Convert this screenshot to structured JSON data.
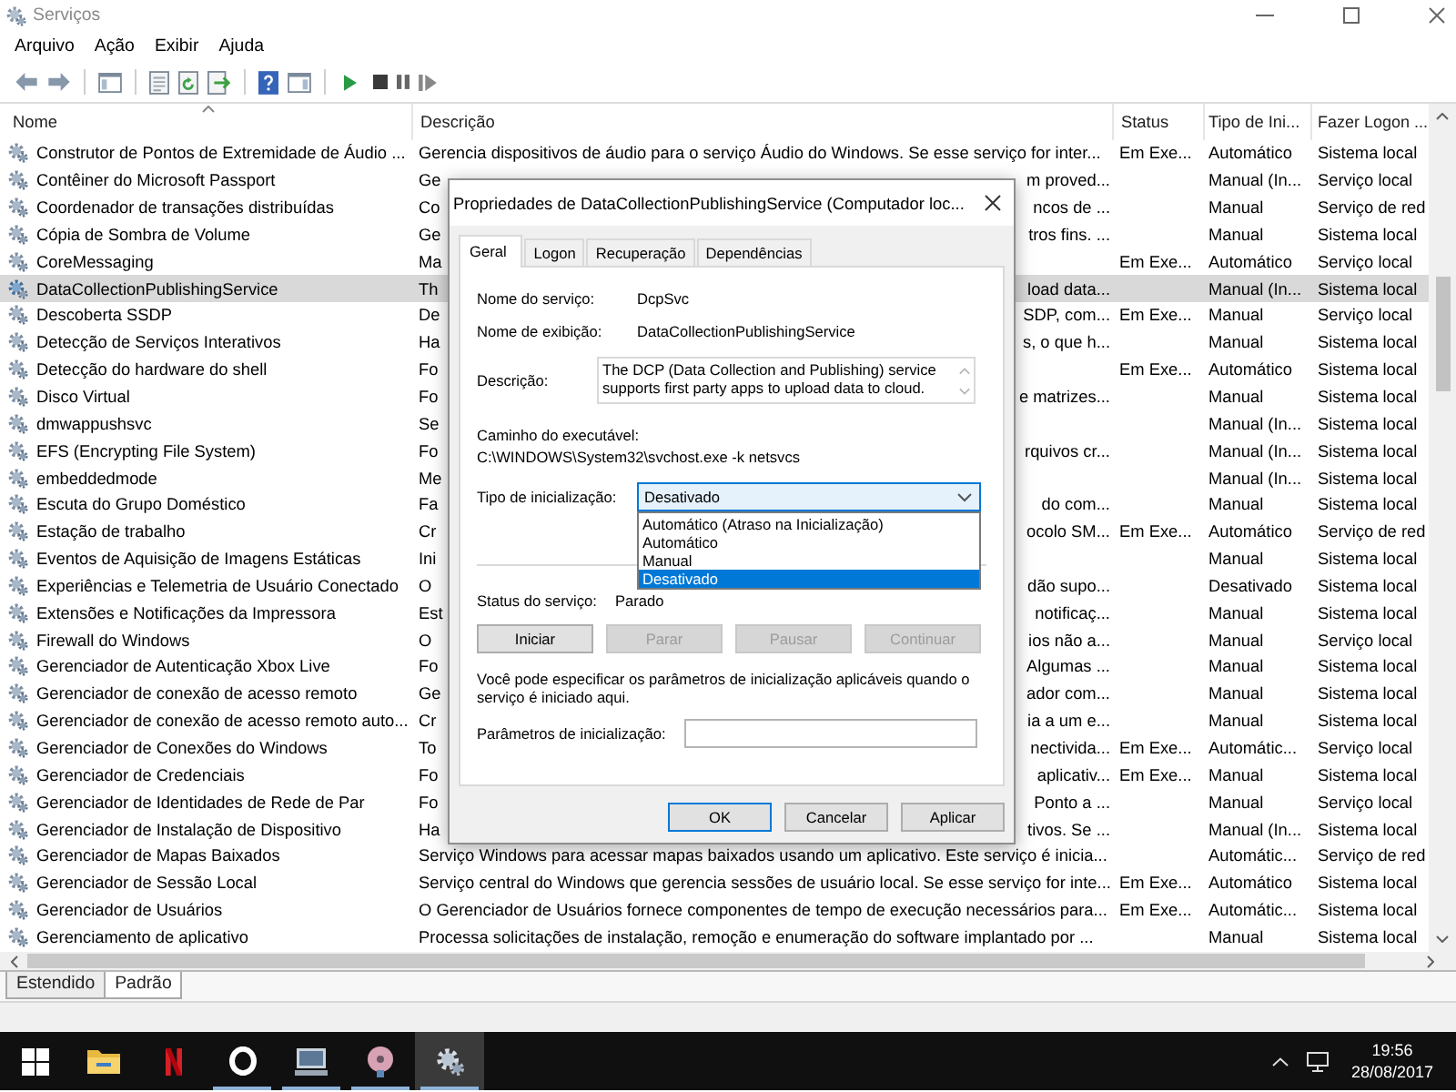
{
  "window": {
    "title": "Serviços"
  },
  "menu": [
    "Arquivo",
    "Ação",
    "Exibir",
    "Ajuda"
  ],
  "list": {
    "columns": [
      "Nome",
      "Descrição",
      "Status",
      "Tipo de Ini...",
      "Fazer Logon ..."
    ],
    "rows": [
      {
        "name": "Construtor de Pontos de Extremidade de Áudio ...",
        "description": "Gerencia dispositivos de áudio para o serviço Áudio do Windows. Se esse serviço for inter...",
        "status": "Em Exe...",
        "startup": "Automático",
        "logon": "Sistema local",
        "selected": false
      },
      {
        "name": "Contêiner do Microsoft Passport",
        "description_parts": [
          "Ge",
          "m proved..."
        ],
        "startup": "Manual (In...",
        "logon": "Serviço local",
        "selected": false
      },
      {
        "name": "Coordenador de transações distribuídas",
        "description_parts": [
          "Co",
          "ncos de ..."
        ],
        "startup": "Manual",
        "logon": "Serviço de red",
        "selected": false
      },
      {
        "name": "Cópia de Sombra de Volume",
        "description_parts": [
          "Ge",
          "tros fins. ..."
        ],
        "startup": "Manual",
        "logon": "Sistema local",
        "selected": false
      },
      {
        "name": "CoreMessaging",
        "description_parts": [
          "Ma"
        ],
        "status": "Em Exe...",
        "startup": "Automático",
        "logon": "Serviço local",
        "selected": false
      },
      {
        "name": "DataCollectionPublishingService",
        "description_parts": [
          "Th",
          "load data..."
        ],
        "startup": "Manual (In...",
        "logon": "Sistema local",
        "selected": true
      },
      {
        "name": "Descoberta SSDP",
        "description_parts": [
          "De",
          "SDP, com..."
        ],
        "status": "Em Exe...",
        "startup": "Manual",
        "logon": "Serviço local",
        "selected": false
      },
      {
        "name": "Detecção de Serviços Interativos",
        "description_parts": [
          "Ha",
          "s, o que h..."
        ],
        "startup": "Manual",
        "logon": "Sistema local",
        "selected": false
      },
      {
        "name": "Detecção do hardware do shell",
        "description_parts": [
          "Fo"
        ],
        "status": "Em Exe...",
        "startup": "Automático",
        "logon": "Sistema local",
        "selected": false
      },
      {
        "name": "Disco Virtual",
        "description_parts": [
          "Fo",
          "e matrizes..."
        ],
        "startup": "Manual",
        "logon": "Sistema local",
        "selected": false
      },
      {
        "name": "dmwappushsvc",
        "description_parts": [
          "Se"
        ],
        "startup": "Manual (In...",
        "logon": "Sistema local",
        "selected": false
      },
      {
        "name": "EFS (Encrypting File System)",
        "description_parts": [
          "Fo",
          "rquivos cr..."
        ],
        "startup": "Manual (In...",
        "logon": "Sistema local",
        "selected": false
      },
      {
        "name": "embeddedmode",
        "description_parts": [
          "Me"
        ],
        "startup": "Manual (In...",
        "logon": "Sistema local",
        "selected": false
      },
      {
        "name": "Escuta do Grupo Doméstico",
        "description_parts": [
          "Fa",
          "do com..."
        ],
        "startup": "Manual",
        "logon": "Sistema local",
        "selected": false
      },
      {
        "name": "Estação de trabalho",
        "description_parts": [
          "Cr",
          "ocolo SM..."
        ],
        "status": "Em Exe...",
        "startup": "Automático",
        "logon": "Serviço de red",
        "selected": false
      },
      {
        "name": "Eventos de Aquisição de Imagens Estáticas",
        "description_parts": [
          "Ini"
        ],
        "startup": "Manual",
        "logon": "Sistema local",
        "selected": false
      },
      {
        "name": "Experiências e Telemetria de Usuário Conectado",
        "description_parts": [
          "O",
          "dão supo..."
        ],
        "startup": "Desativado",
        "logon": "Sistema local",
        "selected": false
      },
      {
        "name": "Extensões e Notificações da Impressora",
        "description_parts": [
          "Est",
          "notificaç..."
        ],
        "startup": "Manual",
        "logon": "Sistema local",
        "selected": false
      },
      {
        "name": "Firewall do Windows",
        "description_parts": [
          "O",
          "ios não a..."
        ],
        "startup": "Manual",
        "logon": "Serviço local",
        "selected": false
      },
      {
        "name": "Gerenciador de Autenticação Xbox Live",
        "description_parts": [
          "Fo",
          "Algumas ..."
        ],
        "startup": "Manual",
        "logon": "Sistema local",
        "selected": false
      },
      {
        "name": "Gerenciador de conexão de acesso remoto",
        "description_parts": [
          "Ge",
          "ador com..."
        ],
        "startup": "Manual",
        "logon": "Sistema local",
        "selected": false
      },
      {
        "name": "Gerenciador de conexão de acesso remoto auto...",
        "description_parts": [
          "Cr",
          "ia a um e..."
        ],
        "startup": "Manual",
        "logon": "Sistema local",
        "selected": false
      },
      {
        "name": "Gerenciador de Conexões do Windows",
        "description_parts": [
          "To",
          "nectivida..."
        ],
        "status": "Em Exe...",
        "startup": "Automátic...",
        "logon": "Serviço local",
        "selected": false
      },
      {
        "name": "Gerenciador de Credenciais",
        "description_parts": [
          "Fo",
          "aplicativ..."
        ],
        "status": "Em Exe...",
        "startup": "Manual",
        "logon": "Sistema local",
        "selected": false
      },
      {
        "name": "Gerenciador de Identidades de Rede de Par",
        "description_parts": [
          "Fo",
          "Ponto a ..."
        ],
        "startup": "Manual",
        "logon": "Serviço local",
        "selected": false
      },
      {
        "name": "Gerenciador de Instalação de Dispositivo",
        "description_parts": [
          "Ha",
          "tivos. Se ..."
        ],
        "startup": "Manual (In...",
        "logon": "Sistema local",
        "selected": false
      },
      {
        "name": "Gerenciador de Mapas Baixados",
        "description": "Serviço Windows para acessar mapas baixados usando um aplicativo. Este serviço é inicia...",
        "startup": "Automátic...",
        "logon": "Serviço de red",
        "selected": false
      },
      {
        "name": "Gerenciador de Sessão Local",
        "description": "Serviço central do Windows que gerencia sessões de usuário local. Se esse serviço for inte...",
        "status": "Em Exe...",
        "startup": "Automático",
        "logon": "Sistema local",
        "selected": false
      },
      {
        "name": "Gerenciador de Usuários",
        "description": "O Gerenciador de Usuários fornece componentes de tempo de execução necessários para...",
        "status": "Em Exe...",
        "startup": "Automátic...",
        "logon": "Sistema local",
        "selected": false
      },
      {
        "name": "Gerenciamento de aplicativo",
        "description": "Processa solicitações de instalação, remoção e enumeração do software implantado por ...",
        "startup": "Manual",
        "logon": "Sistema local",
        "selected": false
      }
    ]
  },
  "view_tabs": [
    {
      "label": "Estendido",
      "selected": false
    },
    {
      "label": "Padrão",
      "selected": true
    }
  ],
  "dialog": {
    "title": "Propriedades de DataCollectionPublishingService (Computador loc...",
    "tabs": [
      {
        "label": "Geral",
        "selected": true
      },
      {
        "label": "Logon",
        "selected": false
      },
      {
        "label": "Recuperação",
        "selected": false
      },
      {
        "label": "Dependências",
        "selected": false
      }
    ],
    "fields": [
      {
        "label": "Nome do serviço:",
        "value": "DcpSvc"
      },
      {
        "label": "Nome de exibição:",
        "value": "DataCollectionPublishingService"
      }
    ],
    "description": {
      "label": "Descrição:",
      "value": "The DCP (Data Collection and Publishing) service supports first party apps to upload data to cloud."
    },
    "path": {
      "label": "Caminho do executável:",
      "value": "C:\\WINDOWS\\System32\\svchost.exe -k netsvcs"
    },
    "startup_type": {
      "label": "Tipo de inicialização:",
      "value": "Desativado",
      "expanded": true,
      "options": [
        {
          "label": "Automático (Atraso na Inicialização)",
          "selected": false
        },
        {
          "label": "Automático",
          "selected": false
        },
        {
          "label": "Manual",
          "selected": false
        },
        {
          "label": "Desativado",
          "selected": true
        }
      ]
    },
    "service_status": {
      "label": "Status do serviço:",
      "value": "Parado"
    },
    "control_buttons": [
      {
        "label": "Iniciar",
        "disabled": false
      },
      {
        "label": "Parar",
        "disabled": true
      },
      {
        "label": "Pausar",
        "disabled": true
      },
      {
        "label": "Continuar",
        "disabled": true
      }
    ],
    "hint": "Você pode especificar os parâmetros de inicialização aplicáveis quando o serviço é iniciado aqui.",
    "parameters": {
      "label": "Parâmetros de inicialização:"
    },
    "buttons": [
      {
        "label": "OK",
        "default": true
      },
      {
        "label": "Cancelar",
        "default": false
      },
      {
        "label": "Aplicar",
        "default": false
      }
    ]
  },
  "taskbar": {
    "apps": [
      {
        "kind": "folder",
        "running": false,
        "active": false
      },
      {
        "kind": "letter",
        "running": false,
        "active": false
      },
      {
        "kind": "ring",
        "running": true,
        "active": false
      },
      {
        "kind": "monitor",
        "running": true,
        "active": false
      },
      {
        "kind": "disc",
        "running": true,
        "active": false
      },
      {
        "kind": "gears",
        "running": true,
        "active": true
      }
    ],
    "time": "19:56",
    "date": "28/08/2017"
  }
}
